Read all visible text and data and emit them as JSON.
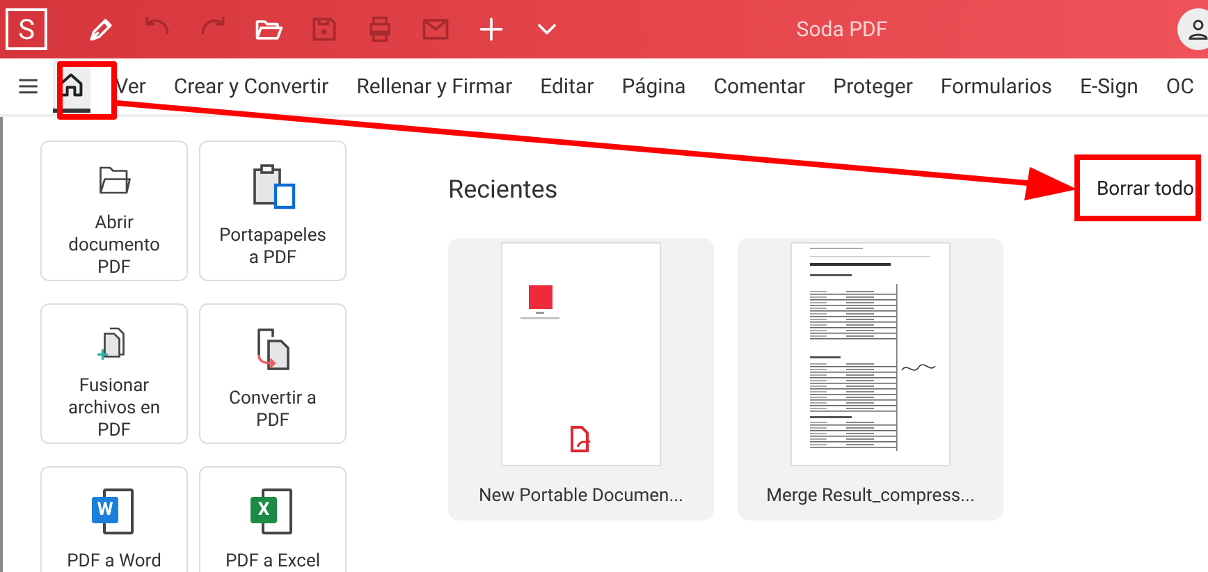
{
  "app": {
    "logo": "S",
    "title": "Soda PDF"
  },
  "toolbar": [
    {
      "kind": "pen",
      "disabled": false
    },
    {
      "kind": "undo",
      "disabled": true
    },
    {
      "kind": "redo",
      "disabled": true
    },
    {
      "kind": "open",
      "disabled": false
    },
    {
      "kind": "save",
      "disabled": true
    },
    {
      "kind": "print",
      "disabled": true
    },
    {
      "kind": "mail",
      "disabled": true
    },
    {
      "kind": "plus",
      "disabled": false
    },
    {
      "kind": "more",
      "disabled": false
    }
  ],
  "tabs": [
    {
      "kind": "home",
      "selected": true
    },
    {
      "label": "Ver",
      "selected": false
    },
    {
      "label": "Crear y Convertir",
      "selected": false
    },
    {
      "label": "Rellenar y Firmar",
      "selected": false
    },
    {
      "label": "Editar",
      "selected": false
    },
    {
      "label": "Página",
      "selected": false
    },
    {
      "label": "Comentar",
      "selected": false
    },
    {
      "label": "Proteger",
      "selected": false
    },
    {
      "label": "Formularios",
      "selected": false
    },
    {
      "label": "E-Sign",
      "selected": false
    },
    {
      "label": "OC",
      "selected": false
    }
  ],
  "tools": [
    {
      "kind": "open",
      "label": "Abrir documento PDF"
    },
    {
      "kind": "clipboard",
      "label": "Portapapeles a PDF"
    },
    {
      "kind": "merge",
      "label": "Fusionar archivos en PDF"
    },
    {
      "kind": "convert",
      "label": "Convertir a PDF"
    },
    {
      "kind": "word",
      "label": "PDF a Word",
      "badge": "W"
    },
    {
      "kind": "excel",
      "label": "PDF a Excel",
      "badge": "X"
    }
  ],
  "recent": {
    "title": "Recientes",
    "clear": "Borrar todo",
    "files": [
      {
        "kind": "blank",
        "name": "New Portable Documen..."
      },
      {
        "kind": "table",
        "name": "Merge Result_compress..."
      }
    ]
  }
}
